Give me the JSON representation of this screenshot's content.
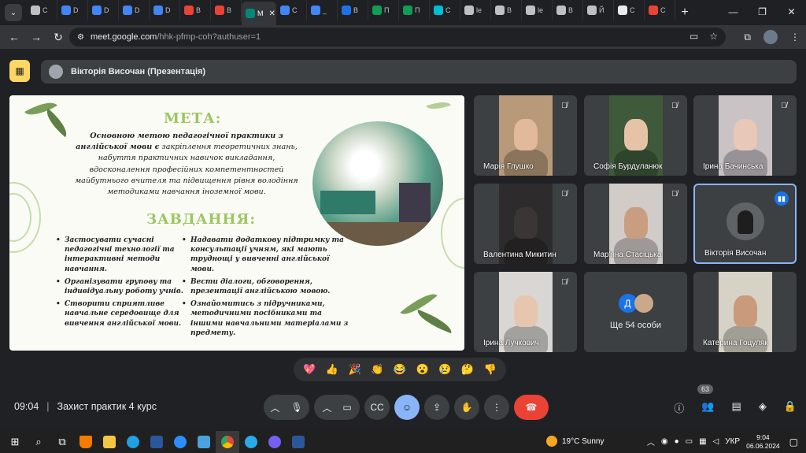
{
  "browser": {
    "tabs": [
      {
        "label": "C",
        "color": "#bdc1c6"
      },
      {
        "label": "D",
        "color": "#4285f4"
      },
      {
        "label": "D",
        "color": "#4285f4"
      },
      {
        "label": "D",
        "color": "#4285f4"
      },
      {
        "label": "D",
        "color": "#4285f4"
      },
      {
        "label": "B",
        "color": "#ea4335"
      },
      {
        "label": "B",
        "color": "#ea4335"
      },
      {
        "label": "M",
        "color": "#00897b",
        "active": true
      },
      {
        "label": "C",
        "color": "#4285f4"
      },
      {
        "label": "_",
        "color": "#4285f4"
      },
      {
        "label": "B",
        "color": "#1a73e8"
      },
      {
        "label": "П",
        "color": "#0f9d58"
      },
      {
        "label": "П",
        "color": "#0f9d58"
      },
      {
        "label": "C",
        "color": "#00bcd4"
      },
      {
        "label": "le",
        "color": "#bdc1c6"
      },
      {
        "label": "B",
        "color": "#bdc1c6"
      },
      {
        "label": "le",
        "color": "#bdc1c6"
      },
      {
        "label": "B",
        "color": "#bdc1c6"
      },
      {
        "label": "Й",
        "color": "#bdc1c6"
      },
      {
        "label": "C",
        "color": "#e8eaed"
      },
      {
        "label": "C",
        "color": "#ea4335"
      }
    ],
    "new_tab": "+",
    "url_host": "meet.google.com",
    "url_path": "/hhk-pfmp-coh?authuser=1"
  },
  "meet": {
    "presenter_label": "Вікторія Височан (Презентація)",
    "slide": {
      "goal_heading": "МЕТА:",
      "goal_text_bold": "Основною метою педагогічної практики з англійської мови є",
      "goal_text_rest": " закріплення теоретичних знань, набуття практичних навичок викладання, вдосконалення професійних компетентностей майбутнього вчителя та підвищення рівня володіння методиками навчання іноземної мови.",
      "tasks_heading": "ЗАВДАННЯ:",
      "tasks_left": [
        "Застосувати сучасні педагогічні технології та інтерактивні методи навчання.",
        "Організувати групову та індивідуальну роботу учнів.",
        "Створити сприятливе навчальне середовище для вивчення англійської мови."
      ],
      "tasks_right": [
        "Надавати додаткову підтримку та консультації учням, які мають труднощі у вивченні англійської мови.",
        "Вести діалоги, обговорення, презентації англійською мовою.",
        "Ознайомитись з підручниками, методичними посібниками та іншими навчальними матеріалами з предмету."
      ]
    },
    "participants": [
      {
        "name": "Марія Глушко",
        "muted": true,
        "bg": "#b89a7a",
        "skin": "#e2b99a"
      },
      {
        "name": "Софія Бурдуланюк",
        "muted": true,
        "bg": "#3f5a3a",
        "skin": "#e6c2a6"
      },
      {
        "name": "Ірина Бачинська",
        "muted": true,
        "bg": "#c9c3c6",
        "skin": "#e8c8b8"
      },
      {
        "name": "Валентина Микитин",
        "muted": true,
        "bg": "#2d2b2b",
        "skin": "#3b3535"
      },
      {
        "name": "Мар'яна Стасіцька",
        "muted": true,
        "bg": "#d2ccc8",
        "skin": "#c99d80"
      },
      {
        "name": "Вікторія Височан",
        "speaking": true
      },
      {
        "name": "Ірина Лучкович",
        "muted": true,
        "bg": "#d9d6d3",
        "skin": "#e7c6b0"
      },
      {
        "more": true,
        "label": "Ще 54 особи",
        "initial": "Д"
      },
      {
        "name": "Катерина Гоцуляк",
        "bg": "#d7d2c6",
        "skin": "#c99a7b"
      }
    ],
    "reactions": [
      "💖",
      "👍",
      "🎉",
      "👏",
      "😂",
      "😮",
      "😢",
      "🤔",
      "👎"
    ],
    "time": "09:04",
    "meeting_title": "Захист практик 4 курс",
    "participants_count": "63"
  },
  "taskbar": {
    "weather": "19°C Sunny",
    "lang": "УКР",
    "time": "9:04",
    "date": "06.06.2024"
  }
}
